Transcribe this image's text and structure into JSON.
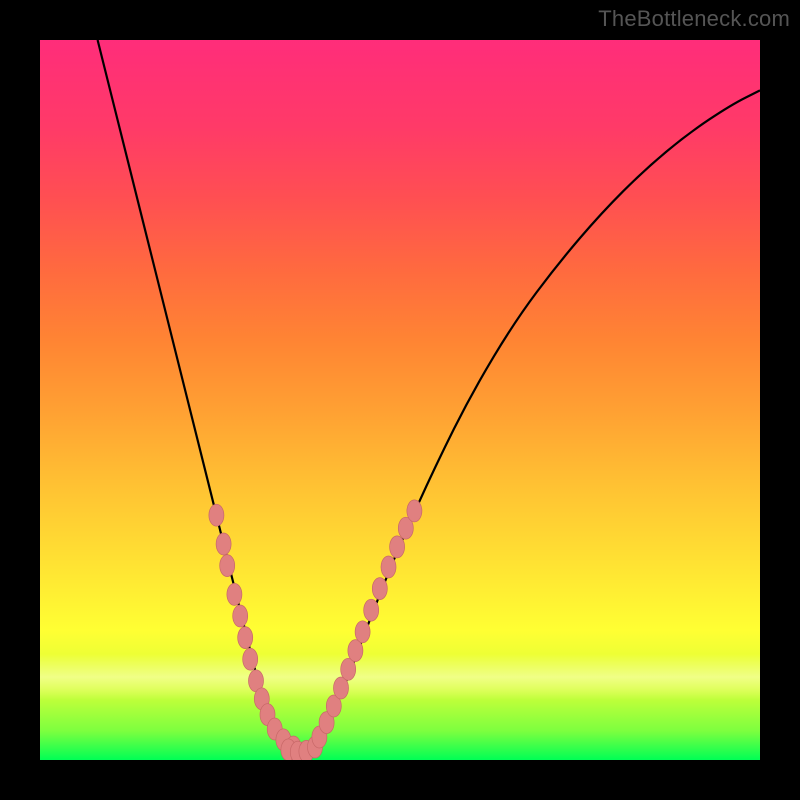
{
  "watermark": "TheBottleneck.com",
  "colors": {
    "curve": "#000000",
    "marker_fill": "#e08080",
    "marker_stroke": "#c86868",
    "bg_black": "#000000"
  },
  "chart_data": {
    "type": "line",
    "title": "",
    "xlabel": "",
    "ylabel": "",
    "xlim": [
      0,
      100
    ],
    "ylim": [
      0,
      100
    ],
    "grid": false,
    "left_branch": [
      {
        "x": 8,
        "y": 100
      },
      {
        "x": 10,
        "y": 92
      },
      {
        "x": 12,
        "y": 84
      },
      {
        "x": 14,
        "y": 76
      },
      {
        "x": 16,
        "y": 68
      },
      {
        "x": 18,
        "y": 60
      },
      {
        "x": 20,
        "y": 52
      },
      {
        "x": 22,
        "y": 44
      },
      {
        "x": 24,
        "y": 36
      },
      {
        "x": 26,
        "y": 28
      },
      {
        "x": 28,
        "y": 20
      },
      {
        "x": 30,
        "y": 12
      },
      {
        "x": 32,
        "y": 6
      },
      {
        "x": 34,
        "y": 2
      },
      {
        "x": 36,
        "y": 1
      }
    ],
    "right_branch": [
      {
        "x": 36,
        "y": 1
      },
      {
        "x": 38,
        "y": 2
      },
      {
        "x": 40,
        "y": 5
      },
      {
        "x": 43,
        "y": 12
      },
      {
        "x": 46,
        "y": 20
      },
      {
        "x": 50,
        "y": 30
      },
      {
        "x": 55,
        "y": 41
      },
      {
        "x": 60,
        "y": 51
      },
      {
        "x": 66,
        "y": 61
      },
      {
        "x": 72,
        "y": 69
      },
      {
        "x": 78,
        "y": 76
      },
      {
        "x": 84,
        "y": 82
      },
      {
        "x": 90,
        "y": 87
      },
      {
        "x": 96,
        "y": 91
      },
      {
        "x": 100,
        "y": 93
      }
    ],
    "markers_left": [
      {
        "x": 24.5,
        "y": 34
      },
      {
        "x": 25.5,
        "y": 30
      },
      {
        "x": 26.0,
        "y": 27
      },
      {
        "x": 27.0,
        "y": 23
      },
      {
        "x": 27.8,
        "y": 20
      },
      {
        "x": 28.5,
        "y": 17
      },
      {
        "x": 29.2,
        "y": 14
      },
      {
        "x": 30.0,
        "y": 11
      },
      {
        "x": 30.8,
        "y": 8.5
      },
      {
        "x": 31.6,
        "y": 6.3
      },
      {
        "x": 32.6,
        "y": 4.3
      },
      {
        "x": 33.8,
        "y": 2.8
      },
      {
        "x": 35.2,
        "y": 1.8
      }
    ],
    "markers_bottom": [
      {
        "x": 34.5,
        "y": 1.4
      },
      {
        "x": 35.8,
        "y": 1.1
      },
      {
        "x": 37.0,
        "y": 1.2
      },
      {
        "x": 38.2,
        "y": 1.8
      }
    ],
    "markers_right": [
      {
        "x": 38.8,
        "y": 3.2
      },
      {
        "x": 39.8,
        "y": 5.2
      },
      {
        "x": 40.8,
        "y": 7.5
      },
      {
        "x": 41.8,
        "y": 10.0
      },
      {
        "x": 42.8,
        "y": 12.6
      },
      {
        "x": 43.8,
        "y": 15.2
      },
      {
        "x": 44.8,
        "y": 17.8
      },
      {
        "x": 46.0,
        "y": 20.8
      },
      {
        "x": 47.2,
        "y": 23.8
      },
      {
        "x": 48.4,
        "y": 26.8
      },
      {
        "x": 49.6,
        "y": 29.6
      },
      {
        "x": 50.8,
        "y": 32.2
      },
      {
        "x": 52.0,
        "y": 34.6
      }
    ]
  }
}
